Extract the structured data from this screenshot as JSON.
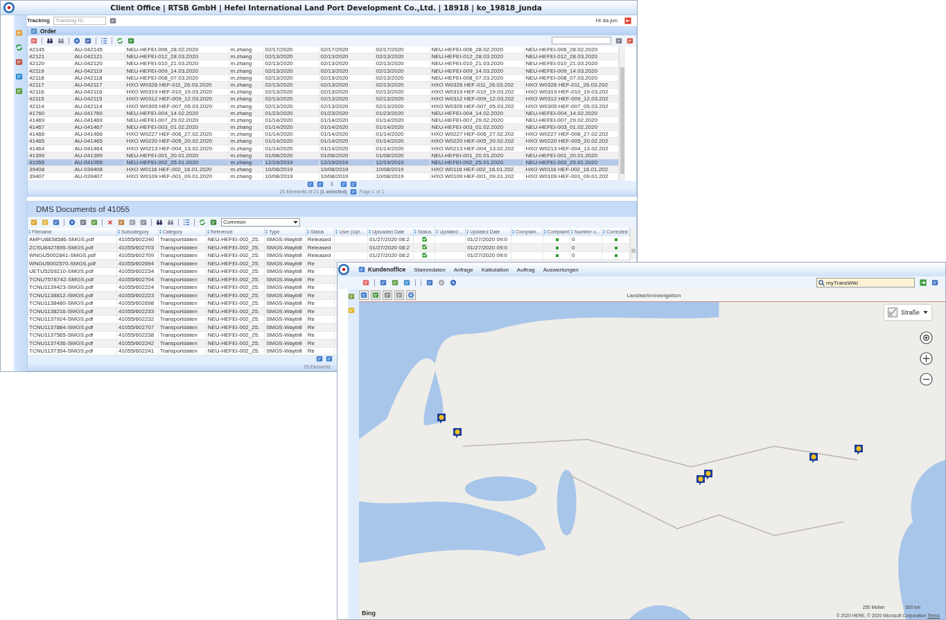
{
  "window": {
    "title": "Client Office | RTSB GmbH | Hefei International Land Port Development Co.,Ltd. | 18918 | ko_19818_junda",
    "greeting": "Hi da jun"
  },
  "tracking": {
    "label": "Tracking",
    "placeholder": "Tracking ID"
  },
  "order": {
    "title": "Order",
    "rows": [
      {
        "cells": [
          "42145",
          "AU-042145",
          "NEU-HEFEI-006_28.02.2020",
          "m.zhang",
          "02/17/2020",
          "02/17/2020",
          "02/17/2020",
          "NEU-HEFEI-006_28.02.2020",
          "NEU-HEFEI-006_28.02.2020"
        ],
        "selected": false
      },
      {
        "cells": [
          "42121",
          "AU-042121",
          "NEU-HEFEI-012_28.03.2020",
          "m.zhang",
          "02/13/2020",
          "02/13/2020",
          "02/13/2020",
          "NEU-HEFEI-012_28.03.2020",
          "NEU-HEFEI-012_28.03.2020"
        ],
        "selected": false
      },
      {
        "cells": [
          "42120",
          "AU-042120",
          "NEU-HEFEI-010_21.03.2020",
          "m.zhang",
          "02/13/2020",
          "02/13/2020",
          "02/13/2020",
          "NEU-HEFEI-010_21.03.2020",
          "NEU-HEFEI-010_21.03.2020"
        ],
        "selected": false
      },
      {
        "cells": [
          "42119",
          "AU-042119",
          "NEU-HEFEI-009_14.03.2020",
          "m.zhang",
          "02/13/2020",
          "02/13/2020",
          "02/13/2020",
          "NEU-HEFEI-009_14.03.2020",
          "NEU-HEFEI-009_14.03.2020"
        ],
        "selected": false
      },
      {
        "cells": [
          "42118",
          "AU-042118",
          "NEU-HEFEI-008_07.03.2020",
          "m.zhang",
          "02/13/2020",
          "02/13/2020",
          "02/13/2020",
          "NEU-HEFEI-008_07.03.2020",
          "NEU-HEFEI-008_07.03.2020"
        ],
        "selected": false
      },
      {
        "cells": [
          "42117",
          "AU-042117",
          "HXO W0326 HEF-011_26.03.2020",
          "m.zhang",
          "02/13/2020",
          "02/13/2020",
          "02/13/2020",
          "HXO W0326 HEF-011_26.03.202",
          "HXO W0326 HEF-011_26.03.202"
        ],
        "selected": false
      },
      {
        "cells": [
          "42116",
          "AU-042116",
          "HXO W0319 HEF-010_19.03.2020",
          "m.zhang",
          "02/13/2020",
          "02/13/2020",
          "02/13/2020",
          "HXO W0319 HEF-010_19.03.202",
          "HXO W0319 HEF-010_19.03.202"
        ],
        "selected": false
      },
      {
        "cells": [
          "42115",
          "AU-042115",
          "HXO W0312 HEF-009_12.03.2020",
          "m.zhang",
          "02/13/2020",
          "02/13/2020",
          "02/13/2020",
          "HXO W0312 HEF-009_12.03.202",
          "HXO W0312 HEF-009_12.03.202"
        ],
        "selected": false
      },
      {
        "cells": [
          "42114",
          "AU-042114",
          "HXO W0305 HEF-007_05.03.2020",
          "m.zhang",
          "02/13/2020",
          "02/13/2020",
          "02/13/2020",
          "HXO W0305 HEF-007_05.03.202",
          "HXO W0305 HEF-007_05.03.202"
        ],
        "selected": false
      },
      {
        "cells": [
          "41760",
          "AU-041760",
          "NEU-HEFEI-004_14.02.2020",
          "m.zhang",
          "01/23/2020",
          "01/23/2020",
          "01/23/2020",
          "NEU-HEFEI-004_14.02.2020",
          "NEU-HEFEI-004_14.02.2020"
        ],
        "selected": false
      },
      {
        "cells": [
          "41469",
          "AU-041469",
          "NEU-HEFEI-007_29.02.2020",
          "m.zhang",
          "01/14/2020",
          "01/14/2020",
          "01/14/2020",
          "NEU-HEFEI-007_29.02.2020",
          "NEU-HEFEI-007_29.02.2020"
        ],
        "selected": false
      },
      {
        "cells": [
          "41467",
          "AU-041467",
          "NEU-HEFEI-003_01.02.2020",
          "m.zhang",
          "01/14/2020",
          "01/14/2020",
          "01/14/2020",
          "NEU-HEFEI-003_01.02.2020",
          "NEU-HEFEI-003_01.02.2020"
        ],
        "selected": false
      },
      {
        "cells": [
          "41466",
          "AU-041466",
          "HXO W0227 HEF-006_27.02.2020",
          "m.zhang",
          "01/14/2020",
          "01/14/2020",
          "01/14/2020",
          "HXO W0227 HEF-006_27.02.202",
          "HXO W0227 HEF-006_27.02.202"
        ],
        "selected": false
      },
      {
        "cells": [
          "41465",
          "AU-041465",
          "HXO W0220 HEF-005_20.02.2020",
          "m.zhang",
          "01/14/2020",
          "01/14/2020",
          "01/14/2020",
          "HXO W0220 HEF-005_20.02.202",
          "HXO W0220 HEF-005_20.02.202"
        ],
        "selected": false
      },
      {
        "cells": [
          "41464",
          "AU-041464",
          "HXO W0213 HEF-004_13.02.2020",
          "m.zhang",
          "01/14/2020",
          "01/14/2020",
          "01/14/2020",
          "HXO W0213 HEF-004_13.02.202",
          "HXO W0213 HEF-004_13.02.202"
        ],
        "selected": false
      },
      {
        "cells": [
          "41399",
          "AU-041399",
          "NEU-HEFEI-001_20.01.2020",
          "m.zhang",
          "01/08/2020",
          "01/08/2020",
          "01/08/2020",
          "NEU-HEFEI-001_20.01.2020",
          "NEU-HEFEI-001_20.01.2020"
        ],
        "selected": false
      },
      {
        "cells": [
          "41055",
          "AU-041055",
          "NEU-HEFEI-002_25.01.2020",
          "m.zhang",
          "12/19/2019",
          "12/19/2019",
          "12/19/2019",
          "NEU-HEFEI-002_25.01.2020",
          "NEU-HEFEI-002_25.01.2020"
        ],
        "selected": true
      },
      {
        "cells": [
          "39408",
          "AU-039408",
          "HXO W0116 HEF-002_16.01.2020",
          "m.zhang",
          "10/08/2019",
          "10/08/2019",
          "10/08/2019",
          "HXO W0116 HEF-002_16.01.202",
          "HXO W0116 HEF-002_16.01.202"
        ],
        "selected": false
      },
      {
        "cells": [
          "39407",
          "AU-039407",
          "HXO W0109 HEF-001_09.01.2020",
          "m.zhang",
          "10/08/2019",
          "10/08/2019",
          "10/08/2019",
          "HXO W0109 HEF-001_09.01.202",
          "HXO W0109 HEF-001_09.01.202"
        ],
        "selected": false
      }
    ],
    "page": "1",
    "footer": "21 Elements of 21 **(1 selected)**",
    "page_info": "Page 1 of 1"
  },
  "dms": {
    "title": "DMS Documents of 41055",
    "filter": "Common",
    "columns": [
      "Filename",
      "Subcategory",
      "Category",
      "Reference",
      "Type",
      "Status",
      "User (Upl...",
      "Uploaded Date",
      "Status",
      "Updated ...",
      "Updated Date",
      "Complain...",
      "Complaint",
      "Number o...",
      "Corrected"
    ],
    "rows": [
      {
        "kind": "full",
        "cells": [
          "AMFU8838586-SMGS.pdf",
          "41055/602240",
          "Transportdaten",
          "NEU-HEFEI-002_25.",
          "SMGS-Waybill",
          "Released"
        ],
        "uploaded": "01/27/2020 08:2",
        "updated": "01/27/2020 09:0",
        "number": "0"
      },
      {
        "kind": "full",
        "cells": [
          "ZCSU8427895-SMGS.pdf",
          "41055/602703",
          "Transportdaten",
          "NEU-HEFEI-002_25.",
          "SMGS-Waybill",
          "Released"
        ],
        "uploaded": "01/27/2020 08:2",
        "updated": "01/27/2020 09:0",
        "number": "0"
      },
      {
        "kind": "full",
        "cells": [
          "WNGU5002841-SMGS.pdf",
          "41055/602709",
          "Transportdaten",
          "NEU-HEFEI-002_25.",
          "SMGS-Waybill",
          "Released"
        ],
        "uploaded": "01/27/2020 08:2",
        "updated": "01/27/2020 09:0",
        "number": "0"
      },
      {
        "kind": "partial",
        "cells": [
          "WNGU5002570-SMGS.pdf",
          "41055/602694",
          "Transportdaten",
          "NEU-HEFEI-002_25.",
          "SMGS-Waybill",
          "Re"
        ]
      },
      {
        "kind": "partial",
        "cells": [
          "UETU5269210-SMGS.pdf",
          "41055/602234",
          "Transportdaten",
          "NEU-HEFEI-002_25.",
          "SMGS-Waybill",
          "Re"
        ]
      },
      {
        "kind": "partial",
        "cells": [
          "TCNU7578742-SMGS.pdf",
          "41055/602704",
          "Transportdaten",
          "NEU-HEFEI-002_25.",
          "SMGS-Waybill",
          "Re"
        ]
      },
      {
        "kind": "partial",
        "cells": [
          "TCNU1139423-SMGS.pdf",
          "41055/602224",
          "Transportdaten",
          "NEU-HEFEI-002_25.",
          "SMGS-Waybill",
          "Re"
        ]
      },
      {
        "kind": "partial",
        "cells": [
          "TCNU1138812-SMGS.pdf",
          "41055/602223",
          "Transportdaten",
          "NEU-HEFEI-002_25.",
          "SMGS-Waybill",
          "Re"
        ]
      },
      {
        "kind": "partial",
        "cells": [
          "TCNU1138480-SMGS.pdf",
          "41055/602698",
          "Transportdaten",
          "NEU-HEFEI-002_25.",
          "SMGS-Waybill",
          "Re"
        ]
      },
      {
        "kind": "partial",
        "cells": [
          "TCNU1138216-SMGS.pdf",
          "41055/602233",
          "Transportdaten",
          "NEU-HEFEI-002_25.",
          "SMGS-Waybill",
          "Re"
        ]
      },
      {
        "kind": "partial",
        "cells": [
          "TCNU1137924-SMGS.pdf",
          "41055/602232",
          "Transportdaten",
          "NEU-HEFEI-002_25.",
          "SMGS-Waybill",
          "Re"
        ]
      },
      {
        "kind": "partial",
        "cells": [
          "TCNU1137884-SMGS.pdf",
          "41055/602707",
          "Transportdaten",
          "NEU-HEFEI-002_25.",
          "SMGS-Waybill",
          "Re"
        ]
      },
      {
        "kind": "partial",
        "cells": [
          "TCNU1137565-SMGS.pdf",
          "41055/602238",
          "Transportdaten",
          "NEU-HEFEI-002_25.",
          "SMGS-Waybill",
          "Re"
        ]
      },
      {
        "kind": "partial",
        "cells": [
          "TCNU1137436-SMGS.pdf",
          "41055/602242",
          "Transportdaten",
          "NEU-HEFEI-002_25.",
          "SMGS-Waybill",
          "Re"
        ]
      },
      {
        "kind": "partial",
        "cells": [
          "TCNU1137354-SMGS.pdf",
          "41055/602241",
          "Transportdaten",
          "NEU-HEFEI-002_25.",
          "SMGS-Waybill",
          "Re"
        ]
      }
    ],
    "footer": "25 Elements"
  },
  "second_window": {
    "app_name": "Kundenoffice",
    "menu": [
      "Stammdaten",
      "Anfrage",
      "Kalkulation",
      "Auftrag",
      "Auswertungen"
    ],
    "search": {
      "value": "myTransWiki"
    },
    "map_title": "Landkartennavigation",
    "map": {
      "layer": "Straße",
      "provider": "Bing",
      "scale": [
        "250 Meilen",
        "500 km"
      ],
      "copyright": "© 2020 HERE, © 2020 Microsoft Corporation",
      "terms": "Terms"
    }
  }
}
